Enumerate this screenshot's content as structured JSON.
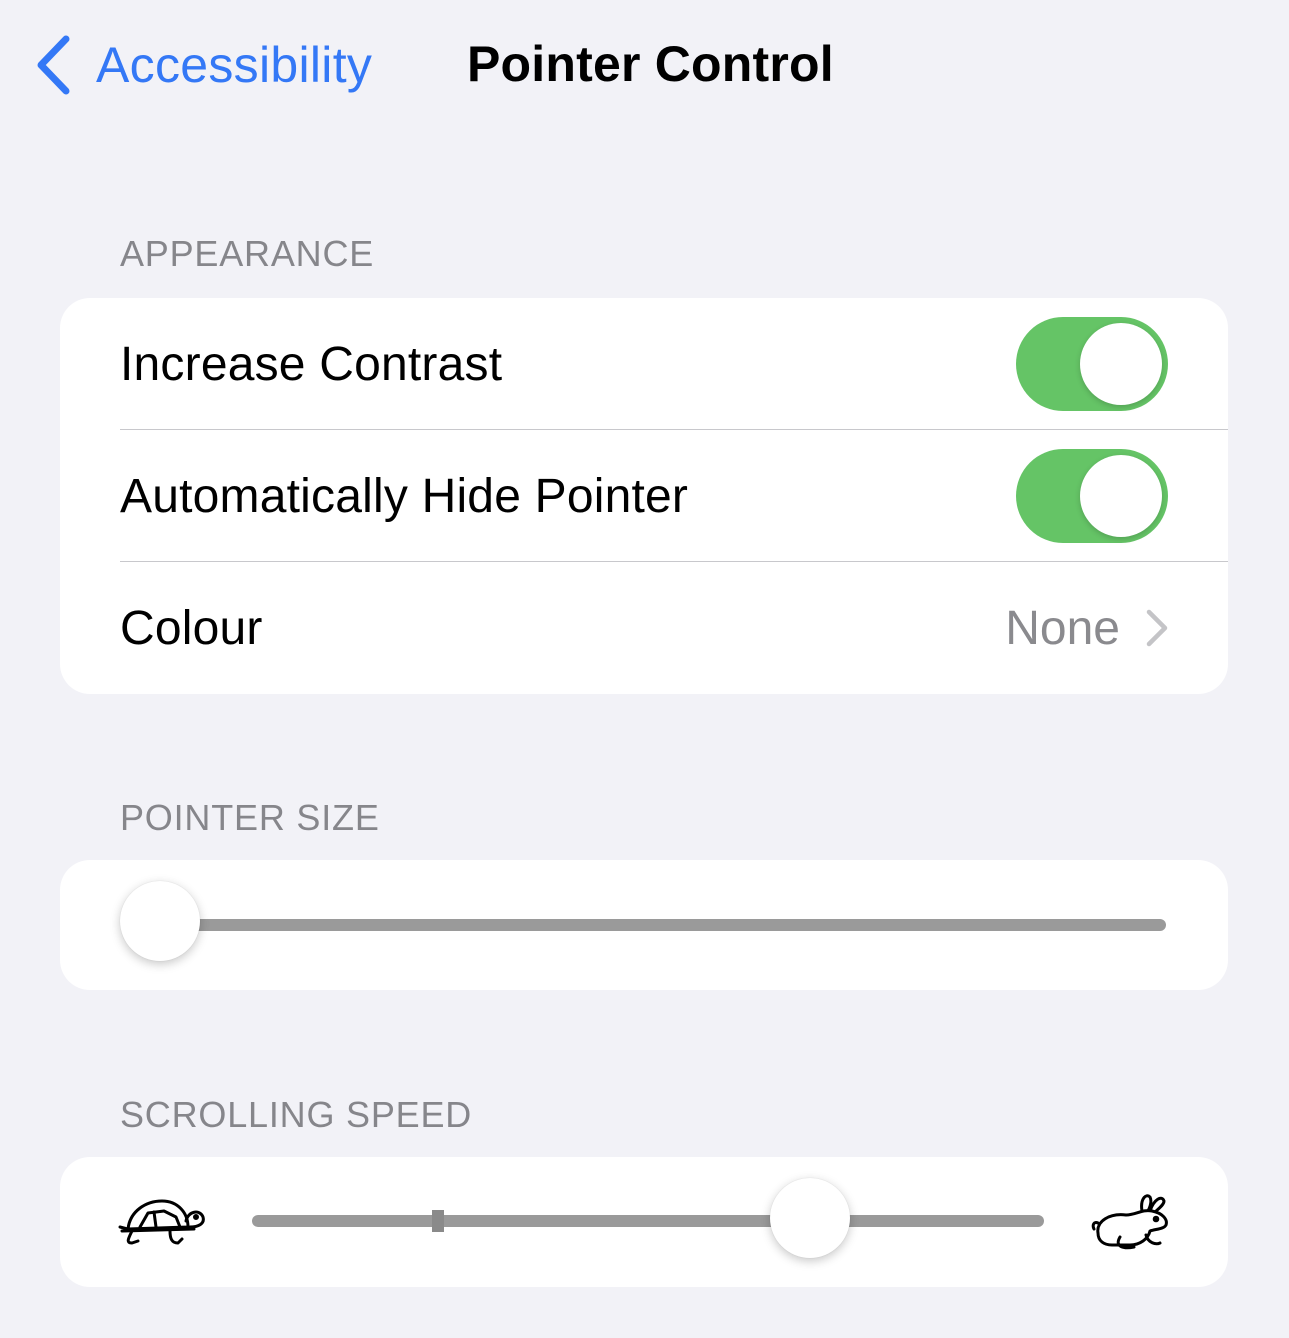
{
  "nav": {
    "back_label": "Accessibility",
    "title": "Pointer Control"
  },
  "appearance": {
    "header": "APPEARANCE",
    "rows": [
      {
        "label": "Increase Contrast",
        "toggle_on": true
      },
      {
        "label": "Automatically Hide Pointer",
        "toggle_on": true
      },
      {
        "label": "Colour",
        "value": "None"
      }
    ]
  },
  "pointer_size": {
    "header": "POINTER SIZE",
    "slider_value": 0.0
  },
  "scrolling_speed": {
    "header": "SCROLLING SPEED",
    "slider_value": 0.705,
    "min_icon": "turtle-icon",
    "max_icon": "rabbit-icon"
  },
  "colors": {
    "accent": "#3478f6",
    "toggle_on": "#65c466",
    "background": "#f2f2f7",
    "secondary_text": "#86868b"
  }
}
